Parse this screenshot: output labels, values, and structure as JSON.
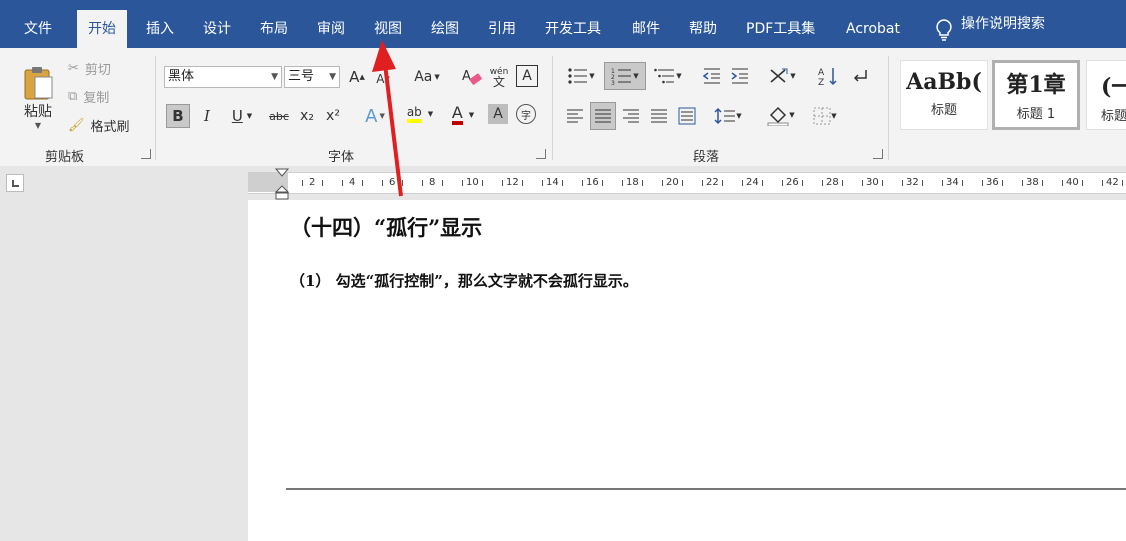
{
  "menu": {
    "tabs": [
      "文件",
      "开始",
      "插入",
      "设计",
      "布局",
      "审阅",
      "视图",
      "绘图",
      "引用",
      "开发工具",
      "邮件",
      "帮助",
      "PDF工具集",
      "Acrobat"
    ],
    "active_index": 1,
    "tell_me": "操作说明搜索"
  },
  "clipboard": {
    "paste": "粘贴",
    "cut": "剪切",
    "copy": "复制",
    "format_painter": "格式刷",
    "group": "剪贴板"
  },
  "font": {
    "name": "黑体",
    "size": "三号",
    "group": "字体",
    "grow": "A",
    "shrink": "A",
    "case": "Aa",
    "phonetic_top": "wén",
    "phonetic_bottom": "文",
    "border": "A",
    "bold": "B",
    "italic": "I",
    "underline": "U",
    "strike": "abc",
    "subscript": "x₂",
    "superscript": "x²",
    "effects": "A",
    "highlight": "ab",
    "color": "A",
    "shade": "A",
    "enclose": "字"
  },
  "paragraph": {
    "group": "段落"
  },
  "styles": {
    "items": [
      {
        "preview": "AaBb(",
        "label": "标题"
      },
      {
        "preview": "第1章",
        "label": "标题 1"
      },
      {
        "preview": "(一",
        "label": "标题"
      }
    ]
  },
  "ruler": {
    "labels": [
      "2",
      "4",
      "6",
      "8",
      "10",
      "12",
      "14",
      "16",
      "18",
      "20",
      "22",
      "24",
      "26",
      "28",
      "30",
      "32",
      "34",
      "36",
      "38",
      "40",
      "42"
    ]
  },
  "document": {
    "heading": "（十四）“孤行”显示",
    "para": "（1） 勾选“孤行控制”，那么文字就不会孤行显示。"
  },
  "colors": {
    "brand": "#2b579a",
    "annotation_arrow": "#e02020"
  }
}
